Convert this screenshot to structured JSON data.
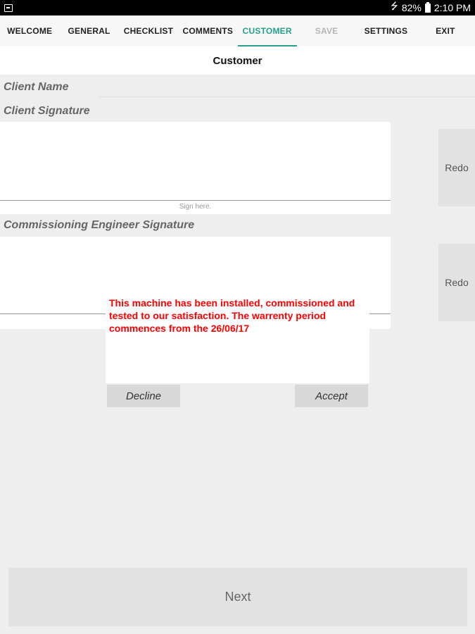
{
  "status_bar": {
    "battery": "82%",
    "time": "2:10 PM"
  },
  "tabs": [
    {
      "label": "WELCOME",
      "state": "normal"
    },
    {
      "label": "GENERAL",
      "state": "normal"
    },
    {
      "label": "CHECKLIST",
      "state": "normal"
    },
    {
      "label": "COMMENTS",
      "state": "normal"
    },
    {
      "label": "CUSTOMER",
      "state": "active"
    },
    {
      "label": "SAVE",
      "state": "disabled"
    },
    {
      "label": "SETTINGS",
      "state": "normal"
    },
    {
      "label": "EXIT",
      "state": "normal"
    }
  ],
  "page_title": "Customer",
  "form": {
    "client_name_label": "Client Name",
    "client_name_value": "",
    "client_signature_label": "Client Signature",
    "sign_hint": "Sign here.",
    "engineer_signature_label": "Commissioning Engineer Signature",
    "redo_label": "Redo"
  },
  "dialog": {
    "message": "This machine has been installed, commissioned and tested to our satisfaction. The warrenty period commences from the 26/06/17",
    "decline_label": "Decline",
    "accept_label": "Accept"
  },
  "next_label": "Next",
  "colors": {
    "accent": "#26a08c",
    "warning_text": "#ff0000"
  }
}
